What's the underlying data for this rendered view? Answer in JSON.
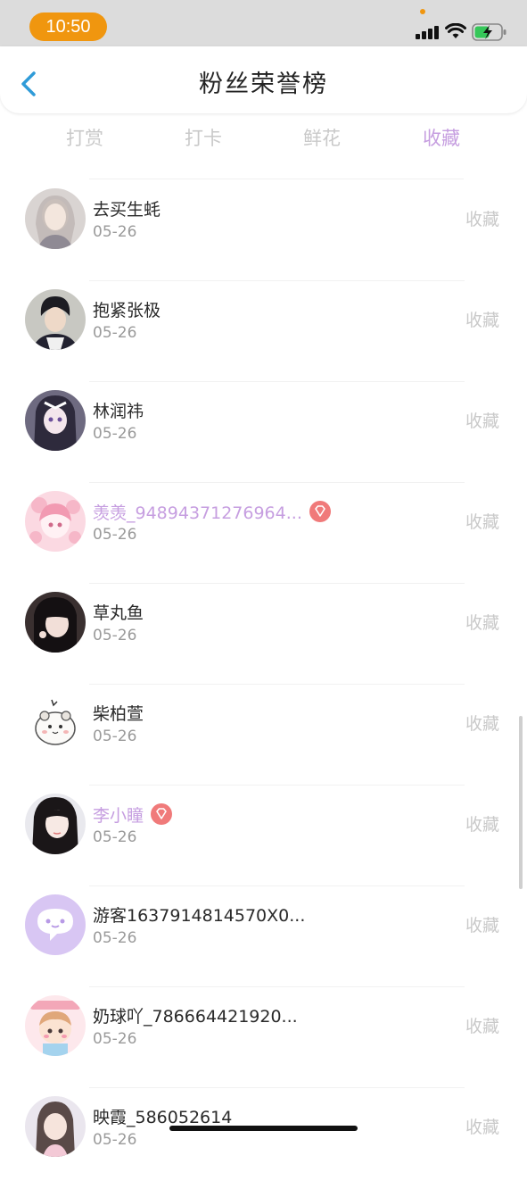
{
  "status_bar": {
    "time": "10:50"
  },
  "header": {
    "title": "粉丝荣誉榜"
  },
  "tabs": [
    {
      "label": "打赏",
      "active": false
    },
    {
      "label": "打卡",
      "active": false
    },
    {
      "label": "鲜花",
      "active": false
    },
    {
      "label": "收藏",
      "active": true
    }
  ],
  "colors": {
    "accent": "#c69ee0",
    "time_pill": "#f0960f",
    "vip_badge": "#f07a7a"
  },
  "fans": [
    {
      "name": "去买生蚝",
      "date": "05-26",
      "action": "收藏",
      "vip": false,
      "avatar": "girl-photo-avatar"
    },
    {
      "name": "抱紧张极",
      "date": "05-26",
      "action": "收藏",
      "vip": false,
      "avatar": "boy-photo-avatar"
    },
    {
      "name": "林润祎",
      "date": "05-26",
      "action": "收藏",
      "vip": false,
      "avatar": "anime-girl-avatar"
    },
    {
      "name": "羡羡_94894371276964...",
      "date": "05-26",
      "action": "收藏",
      "vip": true,
      "avatar": "pink-anime-avatar"
    },
    {
      "name": "草丸鱼",
      "date": "05-26",
      "action": "收藏",
      "vip": false,
      "avatar": "girl-photo-avatar"
    },
    {
      "name": "柴柏萱",
      "date": "05-26",
      "action": "收藏",
      "vip": false,
      "avatar": "cartoon-hamster-avatar"
    },
    {
      "name": "李小瞳",
      "date": "05-26",
      "action": "收藏",
      "vip": true,
      "avatar": "girl-photo-avatar"
    },
    {
      "name": "游客1637914814570X0...",
      "date": "05-26",
      "action": "收藏",
      "vip": false,
      "avatar": "chat-bubble-avatar"
    },
    {
      "name": "奶球吖_786664421920...",
      "date": "05-26",
      "action": "收藏",
      "vip": false,
      "avatar": "cartoon-doll-avatar"
    },
    {
      "name": "映霞_586052614",
      "date": "05-26",
      "action": "收藏",
      "vip": false,
      "avatar": "girl-photo-avatar"
    }
  ]
}
